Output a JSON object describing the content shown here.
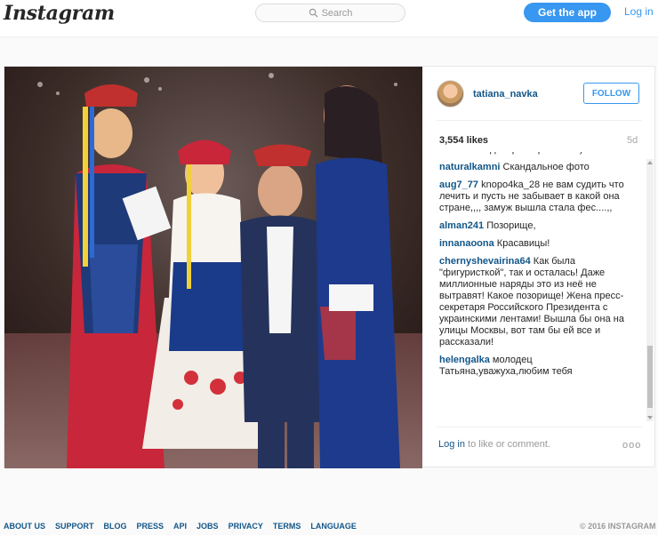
{
  "header": {
    "logo": "Instagram",
    "search_placeholder": "Search",
    "get_app_label": "Get the app",
    "login_label": "Log in"
  },
  "post": {
    "owner": "tatiana_navka",
    "follow_label": "FOLLOW",
    "likes": "3,554 likes",
    "age": "5d",
    "comments": [
      {
        "user": "",
        "text": "вам от нас.днепропетровчанси)"
      },
      {
        "user": "naturalkamni",
        "text": "Скандальное фото"
      },
      {
        "user": "aug7_77",
        "text": "knopo4ka_28 не вам судить что лечить и пусть не забывает в какой она стране,,,, замуж вышла стала фес....,,"
      },
      {
        "user": "alman241",
        "text": "Позорище,"
      },
      {
        "user": "innanaoona",
        "text": "Красавицы!"
      },
      {
        "user": "chernyshevairina64",
        "text": "Как была \"фигуристкой\", так и осталась! Даже миллионные наряды это из неё не вытравят! Какое позорище! Жена пресс- секретаря Российского Президента с украинскими лентами! Вышла бы она на улицы Москвы, вот там бы ей все и рассказали!"
      },
      {
        "user": "helengalka",
        "text": "молодец Татьяна,уважуха,любим тебя"
      }
    ],
    "login_link": "Log in",
    "login_suffix": " to like or comment.",
    "more_label": "ooo"
  },
  "footer": {
    "links": [
      "ABOUT US",
      "SUPPORT",
      "BLOG",
      "PRESS",
      "API",
      "JOBS",
      "PRIVACY",
      "TERMS",
      "LANGUAGE"
    ],
    "copyright": "© 2016 INSTAGRAM"
  }
}
